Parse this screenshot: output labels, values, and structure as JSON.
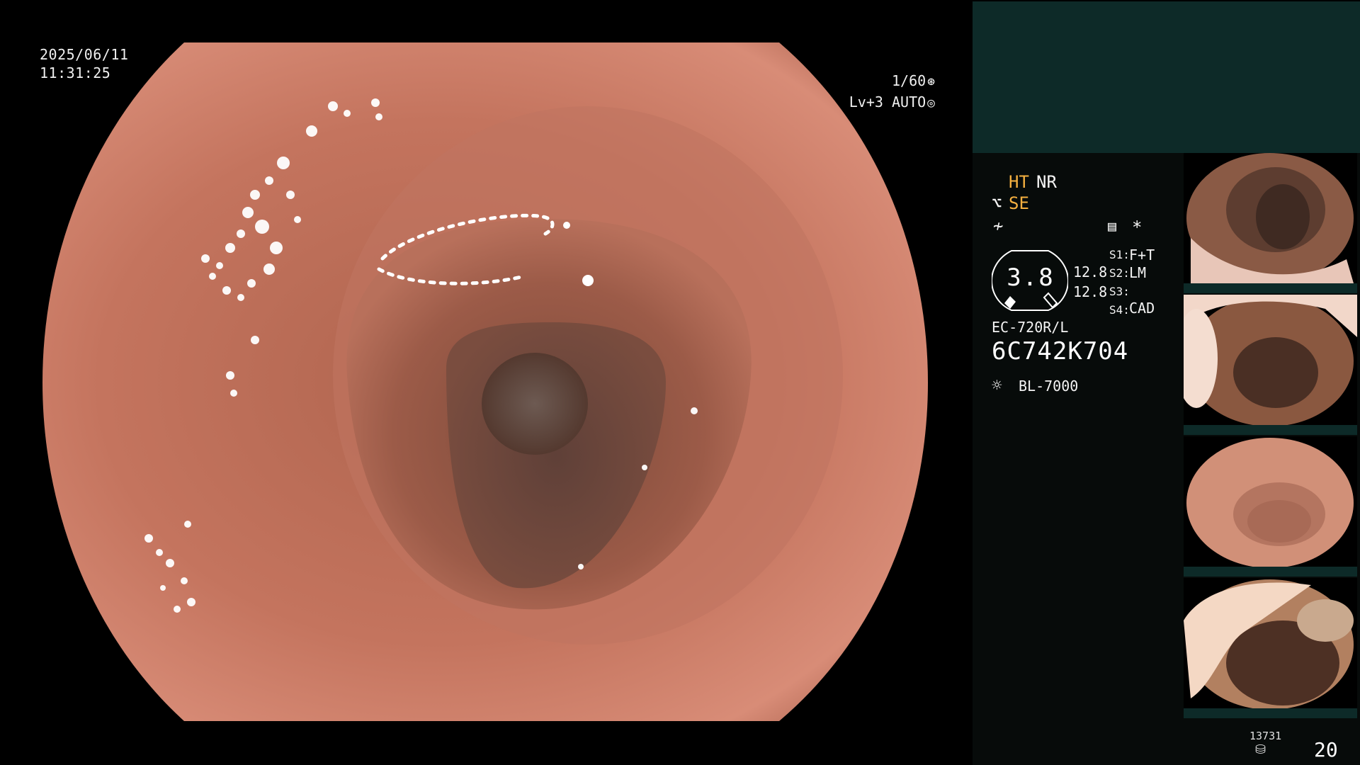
{
  "datetime": {
    "date": "2025/06/11",
    "time": "11:31:25"
  },
  "exposure": {
    "shutter": "1/60",
    "shutter_icon": "aperture-icon",
    "level": "Lv+3",
    "mode": "AUTO",
    "mode_icon": "auto-iris-icon"
  },
  "modes": {
    "ht": "HT",
    "nr": "NR",
    "se": "SE",
    "se_icon": "structure-enhance-icon",
    "freeze_icon": "freeze-icon",
    "menu_icon": "settings-list-icon",
    "asterisk": "*"
  },
  "gauge": {
    "value": "3.8"
  },
  "readouts": {
    "r1": "12.8",
    "r2": "12.8"
  },
  "switches": [
    {
      "label": "S1:",
      "value": "F+T"
    },
    {
      "label": "S2:",
      "value": "LM"
    },
    {
      "label": "S3:",
      "value": ""
    },
    {
      "label": "S4:",
      "value": "CAD"
    }
  ],
  "scope": {
    "model": "EC-720R/L",
    "serial": "6C742K704",
    "light_icon": "light-source-icon",
    "light": "BL-7000"
  },
  "footer": {
    "counter": "13731",
    "disk_icon": "storage-icon",
    "count": "20"
  },
  "colors": {
    "accent": "#f5b040",
    "panel": "#070b0a",
    "panel_top": "#0d2a28"
  }
}
